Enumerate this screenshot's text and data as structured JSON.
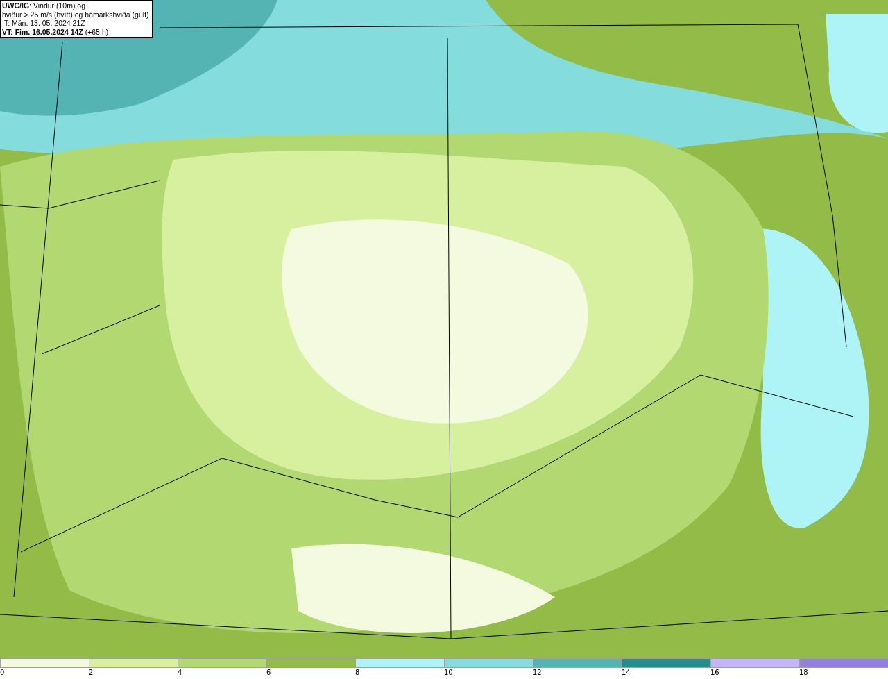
{
  "map": {
    "title_box": {
      "lines": [
        "**UWC/IG**: Vindur (10m) og",
        "hviður > 25 m/s (hvítt) og hámarkshviða (gult)",
        "IT: Mán. 13. 05. 2024 21Z",
        "**VT: Fim. 16.05.2024 14Z** (+65 h)"
      ]
    }
  },
  "legend": {
    "bins": [
      {
        "label": "0",
        "color": "#f4fadf"
      },
      {
        "label": "2",
        "color": "#d7f0a0"
      },
      {
        "label": "4",
        "color": "#b2d872"
      },
      {
        "label": "6",
        "color": "#93bb47"
      },
      {
        "label": "8",
        "color": "#aef4f6"
      },
      {
        "label": "10",
        "color": "#84dcdc"
      },
      {
        "label": "12",
        "color": "#54b4b4"
      },
      {
        "label": "14",
        "color": "#238c8c"
      },
      {
        "label": "16",
        "color": "#c4b4f8"
      },
      {
        "label": "18",
        "color": "#9480dc"
      }
    ]
  }
}
